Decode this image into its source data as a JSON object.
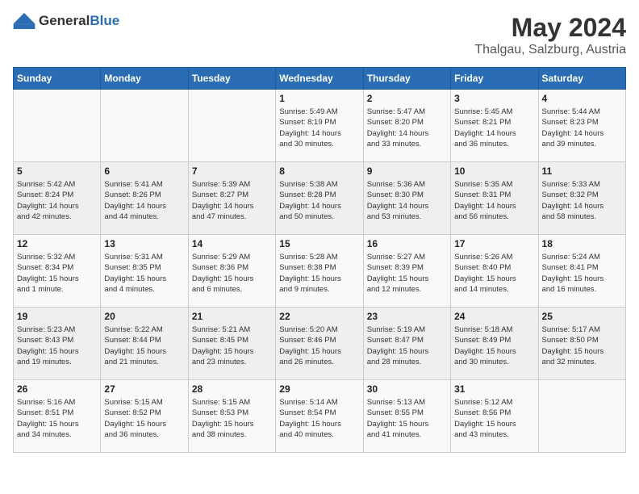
{
  "logo": {
    "general": "General",
    "blue": "Blue"
  },
  "title": {
    "month_year": "May 2024",
    "location": "Thalgau, Salzburg, Austria"
  },
  "days_of_week": [
    "Sunday",
    "Monday",
    "Tuesday",
    "Wednesday",
    "Thursday",
    "Friday",
    "Saturday"
  ],
  "weeks": [
    [
      {
        "day": "",
        "info": ""
      },
      {
        "day": "",
        "info": ""
      },
      {
        "day": "",
        "info": ""
      },
      {
        "day": "1",
        "info": "Sunrise: 5:49 AM\nSunset: 8:19 PM\nDaylight: 14 hours\nand 30 minutes."
      },
      {
        "day": "2",
        "info": "Sunrise: 5:47 AM\nSunset: 8:20 PM\nDaylight: 14 hours\nand 33 minutes."
      },
      {
        "day": "3",
        "info": "Sunrise: 5:45 AM\nSunset: 8:21 PM\nDaylight: 14 hours\nand 36 minutes."
      },
      {
        "day": "4",
        "info": "Sunrise: 5:44 AM\nSunset: 8:23 PM\nDaylight: 14 hours\nand 39 minutes."
      }
    ],
    [
      {
        "day": "5",
        "info": "Sunrise: 5:42 AM\nSunset: 8:24 PM\nDaylight: 14 hours\nand 42 minutes."
      },
      {
        "day": "6",
        "info": "Sunrise: 5:41 AM\nSunset: 8:26 PM\nDaylight: 14 hours\nand 44 minutes."
      },
      {
        "day": "7",
        "info": "Sunrise: 5:39 AM\nSunset: 8:27 PM\nDaylight: 14 hours\nand 47 minutes."
      },
      {
        "day": "8",
        "info": "Sunrise: 5:38 AM\nSunset: 8:28 PM\nDaylight: 14 hours\nand 50 minutes."
      },
      {
        "day": "9",
        "info": "Sunrise: 5:36 AM\nSunset: 8:30 PM\nDaylight: 14 hours\nand 53 minutes."
      },
      {
        "day": "10",
        "info": "Sunrise: 5:35 AM\nSunset: 8:31 PM\nDaylight: 14 hours\nand 56 minutes."
      },
      {
        "day": "11",
        "info": "Sunrise: 5:33 AM\nSunset: 8:32 PM\nDaylight: 14 hours\nand 58 minutes."
      }
    ],
    [
      {
        "day": "12",
        "info": "Sunrise: 5:32 AM\nSunset: 8:34 PM\nDaylight: 15 hours\nand 1 minute."
      },
      {
        "day": "13",
        "info": "Sunrise: 5:31 AM\nSunset: 8:35 PM\nDaylight: 15 hours\nand 4 minutes."
      },
      {
        "day": "14",
        "info": "Sunrise: 5:29 AM\nSunset: 8:36 PM\nDaylight: 15 hours\nand 6 minutes."
      },
      {
        "day": "15",
        "info": "Sunrise: 5:28 AM\nSunset: 8:38 PM\nDaylight: 15 hours\nand 9 minutes."
      },
      {
        "day": "16",
        "info": "Sunrise: 5:27 AM\nSunset: 8:39 PM\nDaylight: 15 hours\nand 12 minutes."
      },
      {
        "day": "17",
        "info": "Sunrise: 5:26 AM\nSunset: 8:40 PM\nDaylight: 15 hours\nand 14 minutes."
      },
      {
        "day": "18",
        "info": "Sunrise: 5:24 AM\nSunset: 8:41 PM\nDaylight: 15 hours\nand 16 minutes."
      }
    ],
    [
      {
        "day": "19",
        "info": "Sunrise: 5:23 AM\nSunset: 8:43 PM\nDaylight: 15 hours\nand 19 minutes."
      },
      {
        "day": "20",
        "info": "Sunrise: 5:22 AM\nSunset: 8:44 PM\nDaylight: 15 hours\nand 21 minutes."
      },
      {
        "day": "21",
        "info": "Sunrise: 5:21 AM\nSunset: 8:45 PM\nDaylight: 15 hours\nand 23 minutes."
      },
      {
        "day": "22",
        "info": "Sunrise: 5:20 AM\nSunset: 8:46 PM\nDaylight: 15 hours\nand 26 minutes."
      },
      {
        "day": "23",
        "info": "Sunrise: 5:19 AM\nSunset: 8:47 PM\nDaylight: 15 hours\nand 28 minutes."
      },
      {
        "day": "24",
        "info": "Sunrise: 5:18 AM\nSunset: 8:49 PM\nDaylight: 15 hours\nand 30 minutes."
      },
      {
        "day": "25",
        "info": "Sunrise: 5:17 AM\nSunset: 8:50 PM\nDaylight: 15 hours\nand 32 minutes."
      }
    ],
    [
      {
        "day": "26",
        "info": "Sunrise: 5:16 AM\nSunset: 8:51 PM\nDaylight: 15 hours\nand 34 minutes."
      },
      {
        "day": "27",
        "info": "Sunrise: 5:15 AM\nSunset: 8:52 PM\nDaylight: 15 hours\nand 36 minutes."
      },
      {
        "day": "28",
        "info": "Sunrise: 5:15 AM\nSunset: 8:53 PM\nDaylight: 15 hours\nand 38 minutes."
      },
      {
        "day": "29",
        "info": "Sunrise: 5:14 AM\nSunset: 8:54 PM\nDaylight: 15 hours\nand 40 minutes."
      },
      {
        "day": "30",
        "info": "Sunrise: 5:13 AM\nSunset: 8:55 PM\nDaylight: 15 hours\nand 41 minutes."
      },
      {
        "day": "31",
        "info": "Sunrise: 5:12 AM\nSunset: 8:56 PM\nDaylight: 15 hours\nand 43 minutes."
      },
      {
        "day": "",
        "info": ""
      }
    ]
  ]
}
